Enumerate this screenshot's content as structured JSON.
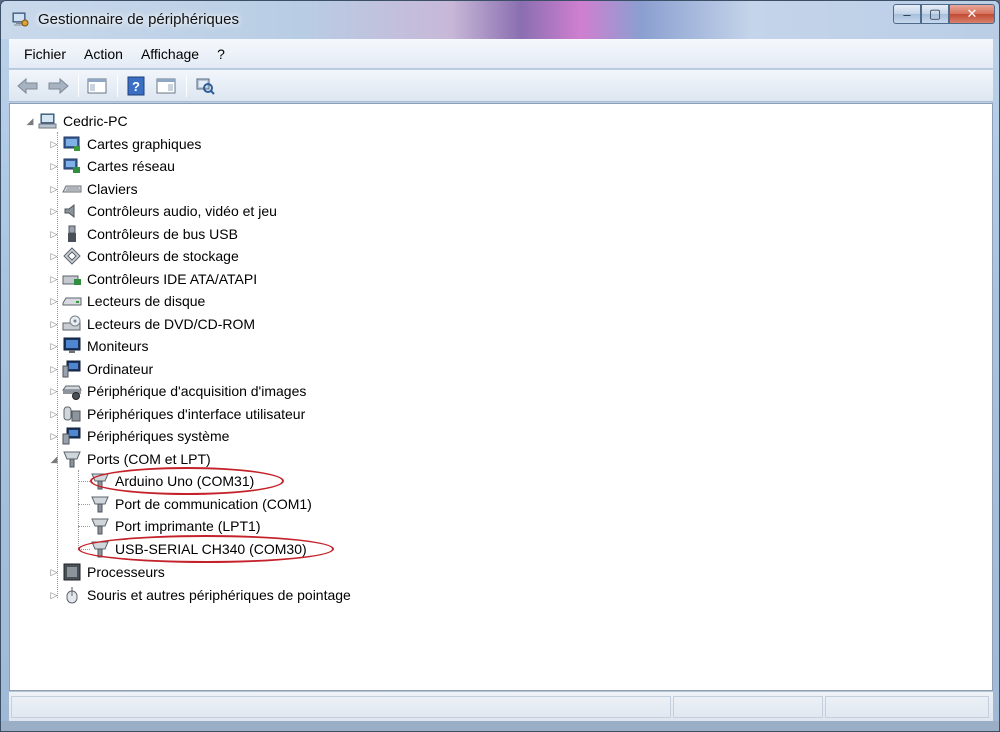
{
  "window": {
    "title": "Gestionnaire de périphériques",
    "min_symbol": "‒",
    "max_symbol": "▢",
    "close_symbol": "✕"
  },
  "menu": [
    "Fichier",
    "Action",
    "Affichage",
    "?"
  ],
  "toolbar": {
    "icons": [
      "back-arrow-icon",
      "forward-arrow-icon",
      "show-hide-console-tree-icon",
      "help-icon",
      "properties-icon",
      "scan-hardware-icon"
    ]
  },
  "tree": {
    "root": "Cedric-PC",
    "categories": [
      {
        "label": "Cartes graphiques",
        "icon": "display-adapter-icon"
      },
      {
        "label": "Cartes réseau",
        "icon": "network-adapter-icon"
      },
      {
        "label": "Claviers",
        "icon": "keyboard-icon"
      },
      {
        "label": "Contrôleurs audio, vidéo et jeu",
        "icon": "audio-icon"
      },
      {
        "label": "Contrôleurs de bus USB",
        "icon": "usb-icon"
      },
      {
        "label": "Contrôleurs de stockage",
        "icon": "storage-controller-icon"
      },
      {
        "label": "Contrôleurs IDE ATA/ATAPI",
        "icon": "ide-controller-icon"
      },
      {
        "label": "Lecteurs de disque",
        "icon": "disk-drive-icon"
      },
      {
        "label": "Lecteurs de DVD/CD-ROM",
        "icon": "dvd-drive-icon"
      },
      {
        "label": "Moniteurs",
        "icon": "monitor-icon"
      },
      {
        "label": "Ordinateur",
        "icon": "computer-icon"
      },
      {
        "label": "Périphérique d'acquisition d'images",
        "icon": "imaging-device-icon"
      },
      {
        "label": "Périphériques d'interface utilisateur",
        "icon": "hid-icon"
      },
      {
        "label": "Périphériques système",
        "icon": "system-device-icon"
      },
      {
        "label": "Ports (COM et LPT)",
        "icon": "port-icon",
        "expanded": true
      },
      {
        "label": "Processeurs",
        "icon": "processor-icon"
      },
      {
        "label": "Souris et autres périphériques de pointage",
        "icon": "mouse-icon"
      }
    ],
    "ports": [
      {
        "label": "Arduino Uno (COM31)",
        "icon": "port-icon",
        "circled": true
      },
      {
        "label": "Port de communication (COM1)",
        "icon": "port-icon"
      },
      {
        "label": "Port imprimante (LPT1)",
        "icon": "port-icon"
      },
      {
        "label": "USB-SERIAL CH340 (COM30)",
        "icon": "port-icon",
        "circled": true
      }
    ]
  },
  "colors": {
    "annotation": "#c4222a"
  }
}
